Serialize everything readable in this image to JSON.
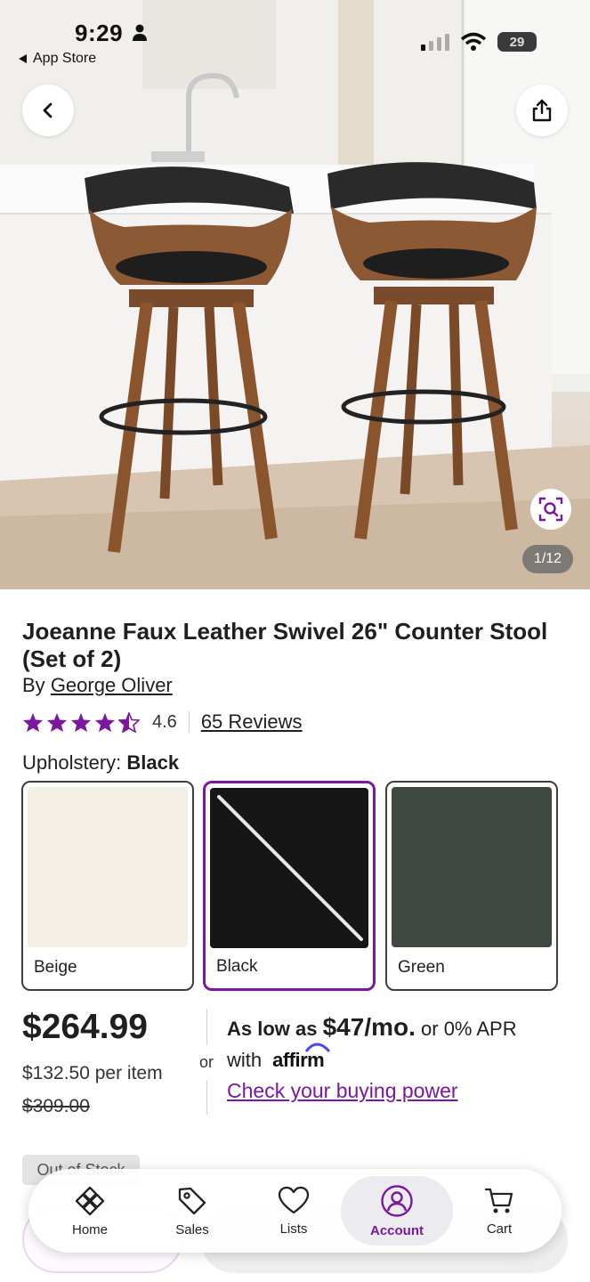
{
  "status_bar": {
    "time": "9:29",
    "back_app": "App Store",
    "battery": "29"
  },
  "gallery": {
    "counter": "1/12"
  },
  "product": {
    "title": "Joeanne Faux Leather Swivel 26\" Counter Stool (Set of 2)",
    "by_prefix": "By",
    "brand": "George Oliver",
    "rating": "4.6",
    "reviews": "65 Reviews",
    "option_label": "Upholstery:",
    "option_selected": "Black",
    "swatches": [
      {
        "name": "Beige",
        "color": "#f4efe4"
      },
      {
        "name": "Black",
        "color": "#161616"
      },
      {
        "name": "Green",
        "color": "#3e4840"
      }
    ]
  },
  "price": {
    "current": "$264.99",
    "per_item": "$132.50 per item",
    "original": "$309.00",
    "or": "or",
    "as_low_prefix": "As low as",
    "monthly": "$47/mo.",
    "apr": "or 0% APR",
    "with": "with",
    "affirm": "affirm",
    "buying_power": "Check your buying power"
  },
  "stock_badge": "Out of Stock",
  "tabbar": [
    {
      "label": "Home",
      "icon": "home-diamond-icon"
    },
    {
      "label": "Sales",
      "icon": "tag-icon"
    },
    {
      "label": "Lists",
      "icon": "heart-icon"
    },
    {
      "label": "Account",
      "icon": "account-icon"
    },
    {
      "label": "Cart",
      "icon": "cart-icon"
    }
  ],
  "colors": {
    "brand_purple": "#7b189f",
    "text": "#1f1f1f"
  }
}
